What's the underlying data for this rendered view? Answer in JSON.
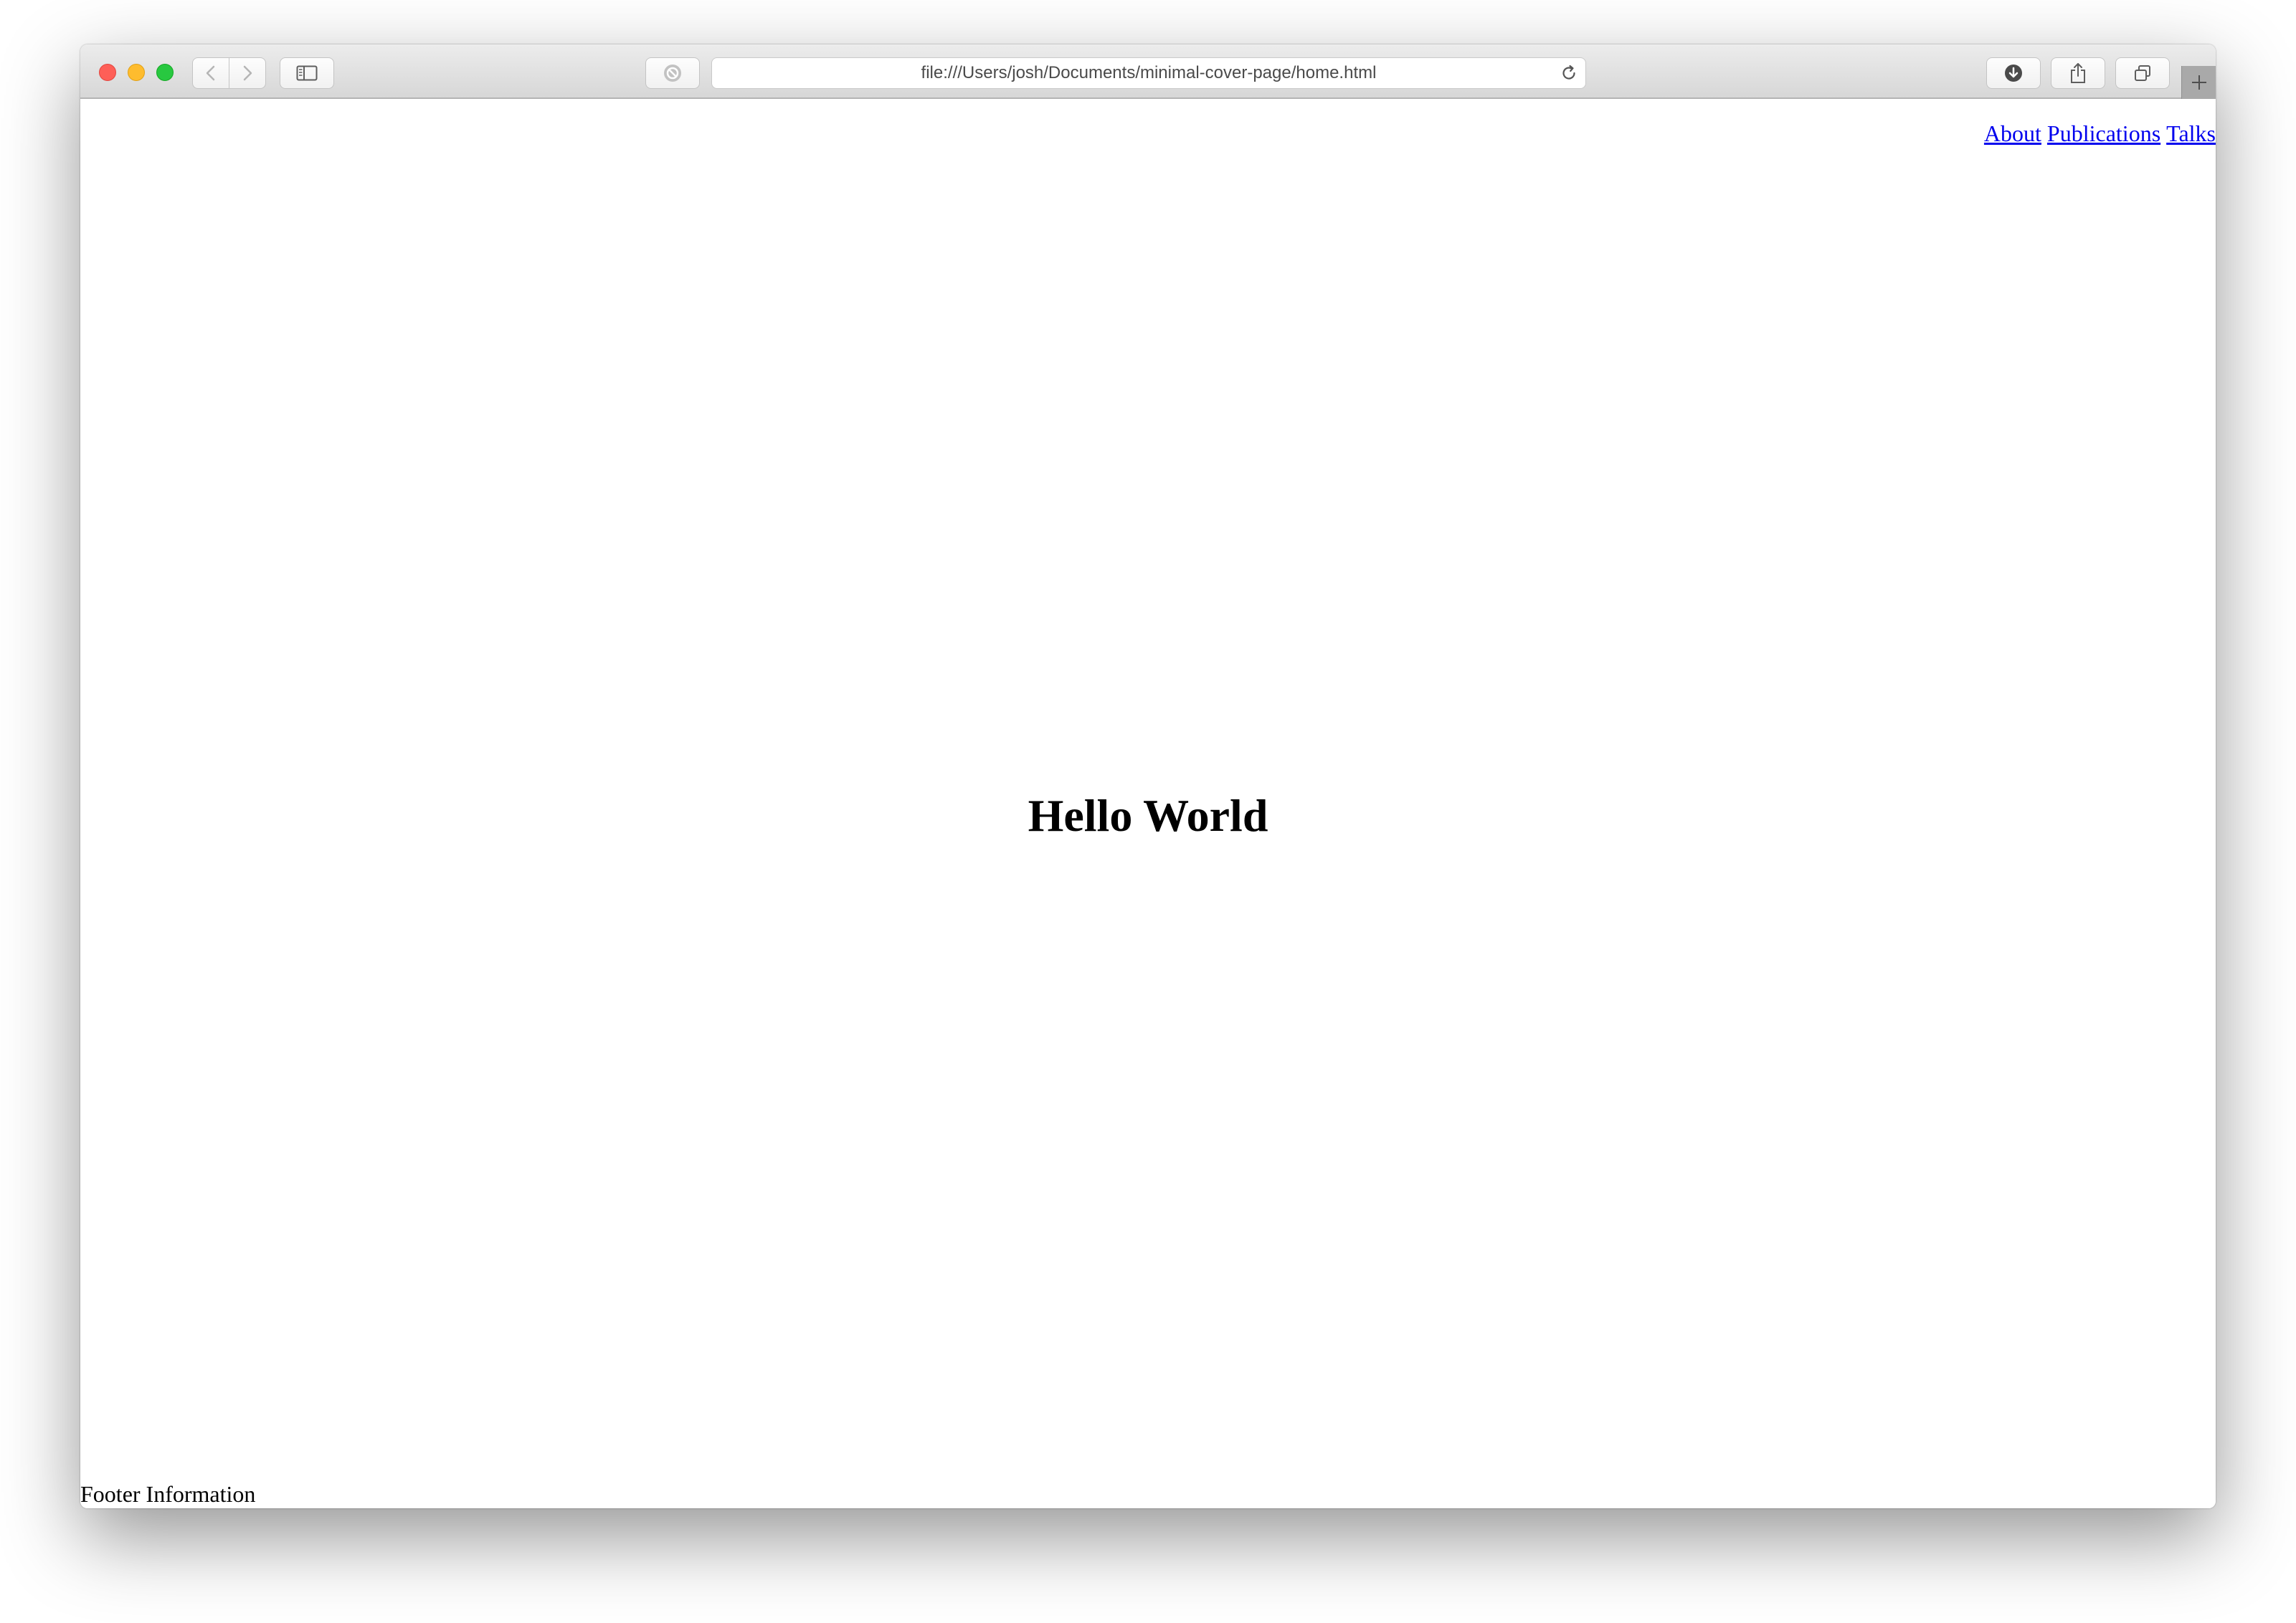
{
  "browser": {
    "url": "file:///Users/josh/Documents/minimal-cover-page/home.html",
    "toolbar_icons": {
      "back": "chevron-left-icon",
      "forward": "chevron-right-icon",
      "sidebar": "sidebar-icon",
      "privacy": "privacy-blocked-icon",
      "reload": "reload-icon",
      "downloads": "download-icon",
      "share": "share-icon",
      "tabs": "tab-overview-icon",
      "new_tab": "plus-icon"
    },
    "traffic_light_colors": {
      "close": "#fe5f57",
      "minimize": "#febc2e",
      "maximize": "#28c840"
    }
  },
  "page": {
    "nav": {
      "links": [
        "About",
        "Publications",
        "Talks"
      ],
      "link_color": "#0000ee"
    },
    "heading": "Hello World",
    "footer": "Footer Information"
  }
}
